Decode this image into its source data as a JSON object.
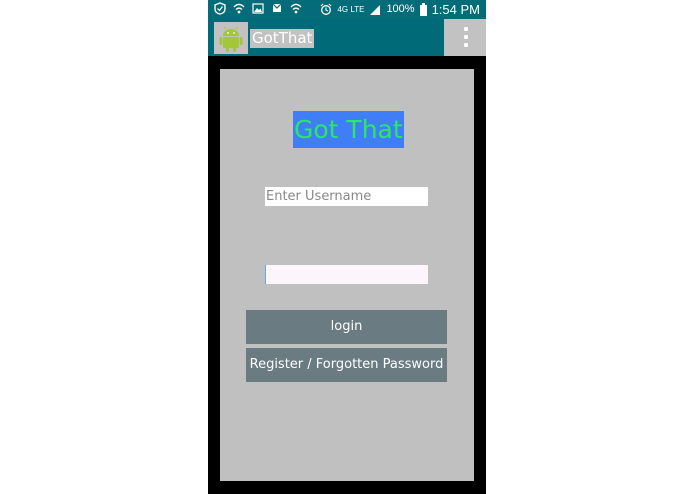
{
  "status_bar": {
    "battery": "100%",
    "time": "1:54 PM",
    "network": "4G LTE",
    "icons": [
      "shield-icon",
      "wifi-icon",
      "image-icon",
      "mail-icon",
      "wifi-icon",
      "alarm-icon",
      "signal-icon",
      "battery-icon"
    ]
  },
  "action_bar": {
    "title": "GotThat",
    "app_icon": "android-icon",
    "overflow_icon": "overflow-menu-icon"
  },
  "login_form": {
    "heading": "Got That",
    "username_placeholder": "Enter Username",
    "username_value": "",
    "password_value": "",
    "login_label": "login",
    "register_label": "Register / Forgotten Password"
  },
  "colors": {
    "status_bar": "#046c78",
    "action_bar": "#006a79",
    "content_bg": "#c0c0c0",
    "heading_bg": "#3f7ef7",
    "heading_text": "#2be85e",
    "button_bg": "#6a7b82"
  }
}
